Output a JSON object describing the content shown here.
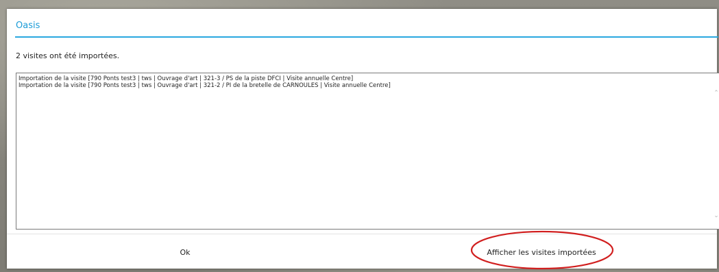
{
  "dialog": {
    "title": "Oasis",
    "message": "2 visites ont été importées.",
    "log_lines": [
      "Importation de la visite [790 Ponts test3 | tws | Ouvrage d'art | 321-3 / PS de la piste DFCI | Visite annuelle Centre]",
      "Importation de la visite [790 Ponts test3 | tws | Ouvrage d'art | 321-2 / PI de la bretelle de CARNOULES | Visite annuelle Centre]"
    ],
    "buttons": {
      "ok_label": "Ok",
      "show_imported_label": "Afficher les visites importées"
    }
  },
  "icons": {
    "scroll_up": "chevron-up-icon",
    "scroll_down": "chevron-down-icon"
  },
  "colors": {
    "accent": "#29a7df",
    "title": "#1a9bd7",
    "annotation": "#d11f1f"
  }
}
